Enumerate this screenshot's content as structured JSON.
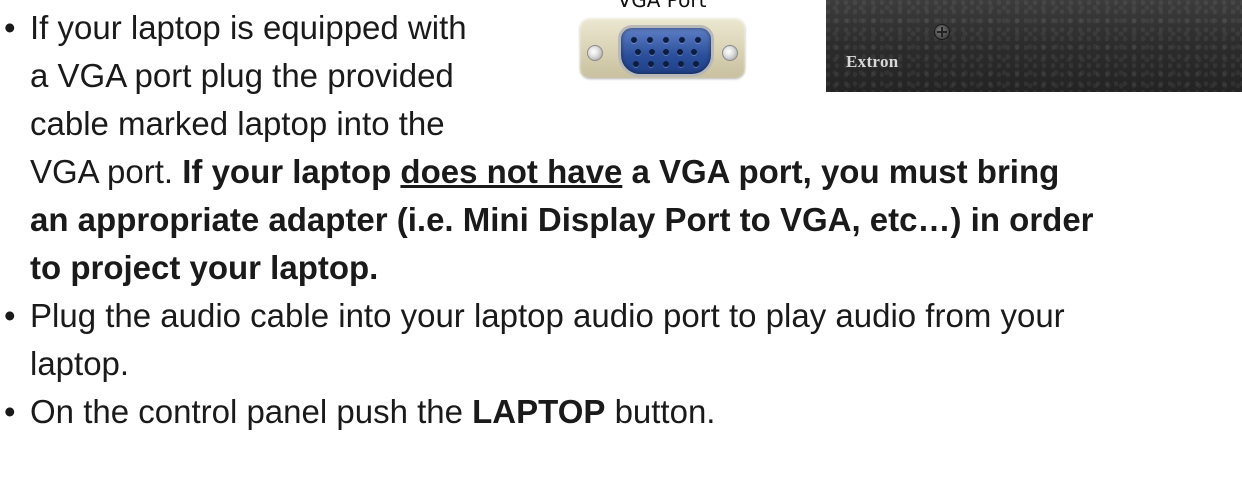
{
  "figure": {
    "vga_label": "VGA Port",
    "panel_brand": "Extron"
  },
  "bullets": {
    "symbol": "•",
    "b1": {
      "line1": "If your laptop is equipped with",
      "line2": "a VGA port plug the provided",
      "line3": "cable marked laptop into the",
      "line4_plain": "VGA port.",
      "line4_bold": "If your laptop",
      "line4_underline": "does not have",
      "line4_bold_end": "a VGA port, you must bring",
      "line5": "an appropriate adapter (i.e. Mini Display Port to VGA, etc…) in order",
      "line6": "to project your laptop."
    },
    "b2": {
      "line1": "Plug the audio cable into your laptop audio port to play audio from your",
      "line2": "laptop."
    },
    "b3": {
      "prefix": "On the control panel push the",
      "button": "LAPTOP",
      "suffix": "button."
    }
  },
  "colors": {
    "text": "#1a1a1a",
    "vga_blue": "#2b4f9c",
    "connector_beige": "#d9d2b4",
    "panel_dark": "#2c2c2c"
  },
  "icons": {
    "vga_port": "vga-port-icon",
    "panel_screw": "screw-icon"
  }
}
